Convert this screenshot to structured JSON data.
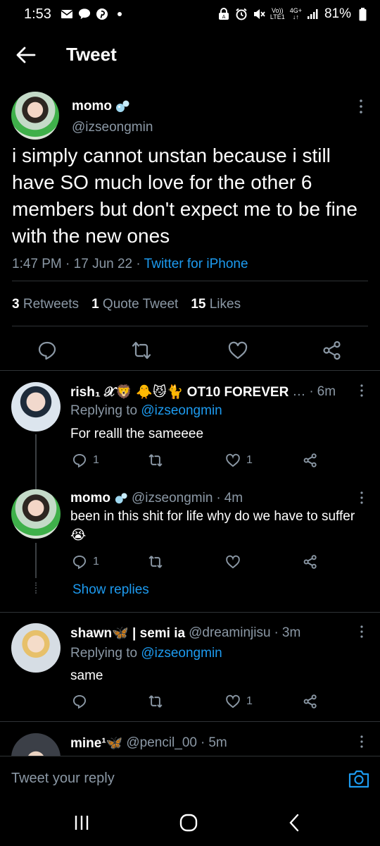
{
  "status_bar": {
    "time": "1:53",
    "battery": "81%",
    "network": "4G+",
    "network_sub": "LTE1",
    "volte": "Vo))"
  },
  "header": {
    "title": "Tweet"
  },
  "main_tweet": {
    "name": "momo",
    "handle": "@izseongmin",
    "text": "i simply cannot unstan because i still have SO much love for the other 6 members but don't expect me to be fine with the new ones",
    "time": "1:47 PM",
    "date": "17 Jun 22",
    "source": "Twitter for iPhone",
    "stats": {
      "retweets_count": "3",
      "retweets_label": "Retweets",
      "quotes_count": "1",
      "quotes_label": "Quote Tweet",
      "likes_count": "15",
      "likes_label": "Likes"
    }
  },
  "replies": [
    {
      "name": "rish₁ 𝒳🦁 🐥😼🐈 OT10 FOREVER",
      "ellipsis": "…",
      "time": "6m",
      "replying_prefix": "Replying to",
      "replying_handle": "@izseongmin",
      "text": "For realll the sameeee",
      "reply_count": "1",
      "like_count": "1"
    },
    {
      "name": "momo",
      "handle": "@izseongmin",
      "time": "4m",
      "text": "been in this shit for life why do we have to suffer😭",
      "reply_count": "1",
      "show_replies": "Show replies"
    },
    {
      "name": "shawn🦋 | semi ia",
      "handle": "@dreaminjisu",
      "time": "3m",
      "replying_prefix": "Replying to",
      "replying_handle": "@izseongmin",
      "text": "same",
      "like_count": "1"
    },
    {
      "name": "mine¹🦋",
      "handle": "@pencil_00",
      "time": "5m"
    }
  ],
  "reply_bar": {
    "placeholder": "Tweet your reply"
  },
  "colors": {
    "accent": "#1d9bf0",
    "background": "#000000",
    "muted": "#8b98a5"
  }
}
